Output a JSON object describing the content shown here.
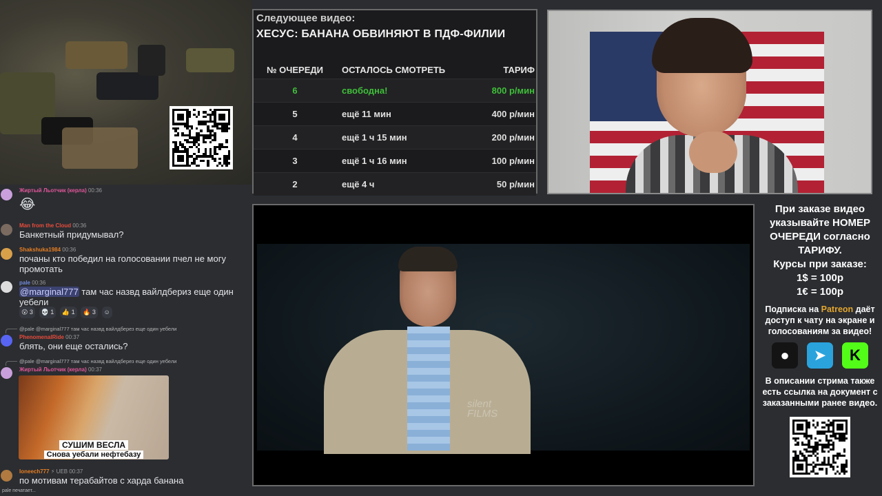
{
  "queue": {
    "next_label": "Следующее видео:",
    "next_title": "ХЕСУС: БАНАНА ОБВИНЯЮТ В ПДФ-ФИЛИИ",
    "headers": [
      "№ ОЧЕРЕДИ",
      "ОСТАЛОСЬ СМОТРЕТЬ",
      "ТАРИФ"
    ],
    "rows": [
      {
        "num": "6",
        "remaining": "свободна!",
        "rate": "800 р/мин"
      },
      {
        "num": "5",
        "remaining": "ещё 11 мин",
        "rate": "400 р/мин"
      },
      {
        "num": "4",
        "remaining": "ещё 1 ч 15 мин",
        "rate": "200 р/мин"
      },
      {
        "num": "3",
        "remaining": "ещё 1 ч 16 мин",
        "rate": "100 р/мин"
      },
      {
        "num": "2",
        "remaining": "ещё 4 ч",
        "rate": "50 р/мин"
      }
    ],
    "free_color": "#3fbf3a"
  },
  "chat": {
    "messages": [
      {
        "user": "Жиртый Льотчик (керла)",
        "time": "00:36",
        "color": "#e0569a",
        "emoji": "😂"
      },
      {
        "user": "Man from the Cloud",
        "time": "00:36",
        "color": "#e74c3c",
        "text": "Банкетный придумывал?"
      },
      {
        "user": "Shakshuka1984",
        "time": "00:36",
        "color": "#e67e22",
        "text": "почаны кто победил на голосовании пчел не могу промотать"
      },
      {
        "user": "pale",
        "time": "00:36",
        "color": "#5865f2",
        "mention": "@marginal777",
        "text": " там  час назвд вайлдбериз еще один уебели",
        "reactions": [
          "😮 3",
          "💀 1",
          "👍 1",
          "🔥 3",
          "☺"
        ]
      },
      {
        "reply": "@pale @marginal777 там  час назвд вайлдберез еще один уебели",
        "user": "PhenomenalRide",
        "time": "00:37",
        "color": "#e74c3c",
        "text": "блять, они еще остались?"
      },
      {
        "reply": "@pale @marginal777 там  час назвд вайлдберез еще один уебели",
        "user": "Жиртый Льотчик (керла)",
        "time": "00:37",
        "color": "#e0569a",
        "attach_cap1": "СУШИМ ВЕСЛА",
        "attach_cap2": "Снова уебали нефтебазу"
      },
      {
        "user": "Ioneech777",
        "badge": "⚡ UEB",
        "time": "00:37",
        "color": "#e67e22",
        "text": "по мотивам терабайтов с харда банана"
      }
    ],
    "typing": "pale печатает..."
  },
  "player": {
    "watermark": "silent\nFILMS"
  },
  "info": {
    "line1": "При заказе видео указывайте НОМЕР ОЧЕРЕДИ согласно ТАРИФУ.",
    "line2": "Курсы при заказе:",
    "rate_usd": "1$ = 100р",
    "rate_eur": "1€ = 100р",
    "sub_pre": "Подписка на ",
    "sub_brand": "Patreon",
    "sub_post": " даёт доступ к чату на экране и голосованиям за видео!",
    "desc": "В описании стрима также есть ссылка на документ с заказанными ранее видео.",
    "gold": "#e3a62e"
  }
}
